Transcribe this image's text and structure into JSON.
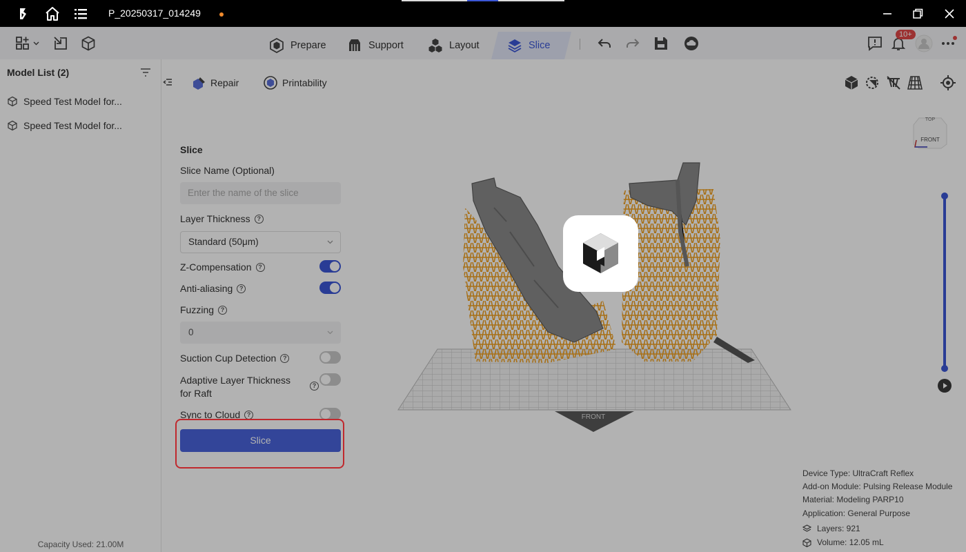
{
  "titlebar": {
    "logo_icon": "chitubox-logo-icon",
    "home_icon": "home-icon",
    "menu_icon": "menu-list-icon",
    "file_name": "P_20250317_014249",
    "unsaved_dot_color": "#f08a2c"
  },
  "toolbar": {
    "tabs": [
      {
        "label": "Prepare",
        "icon": "prepare-icon"
      },
      {
        "label": "Support",
        "icon": "support-icon"
      },
      {
        "label": "Layout",
        "icon": "layout-icon"
      },
      {
        "label": "Slice",
        "icon": "slice-layers-icon",
        "active": true
      }
    ],
    "notification_badge": "10+",
    "accent_color": "#3b57d6"
  },
  "sidebar": {
    "title": "Model List (2)",
    "items": [
      {
        "label": "Speed Test Model for..."
      },
      {
        "label": "Speed Test Model for..."
      }
    ],
    "capacity": "Capacity Used: 21.00M"
  },
  "actions": {
    "repair": "Repair",
    "printability": "Printability"
  },
  "slice_panel": {
    "title": "Slice",
    "slice_name_label": "Slice Name (Optional)",
    "slice_name_placeholder": "Enter the name of the slice",
    "layer_thickness_label": "Layer Thickness",
    "layer_thickness_value": "Standard (50μm)",
    "z_compensation_label": "Z-Compensation",
    "z_compensation_on": true,
    "anti_aliasing_label": "Anti-aliasing",
    "anti_aliasing_on": true,
    "fuzzing_label": "Fuzzing",
    "fuzzing_value": "0",
    "suction_cup_label": "Suction Cup Detection",
    "suction_cup_on": false,
    "adaptive_label": "Adaptive Layer Thickness for Raft",
    "adaptive_on": false,
    "sync_label": "Sync to Cloud",
    "sync_on": false,
    "slice_button": "Slice"
  },
  "viewport": {
    "front_label": "FRONT",
    "cube_top": "TOP",
    "cube_front": "FRONT"
  },
  "info": {
    "device_type": "Device Type:  UltraCraft Reflex",
    "addon_module": "Add-on Module:  Pulsing Release Module",
    "material": "Material:  Modeling PARP10",
    "application": "Application:  General Purpose",
    "layers": "Layers: 921",
    "volume": "Volume: 12.05 mL"
  }
}
